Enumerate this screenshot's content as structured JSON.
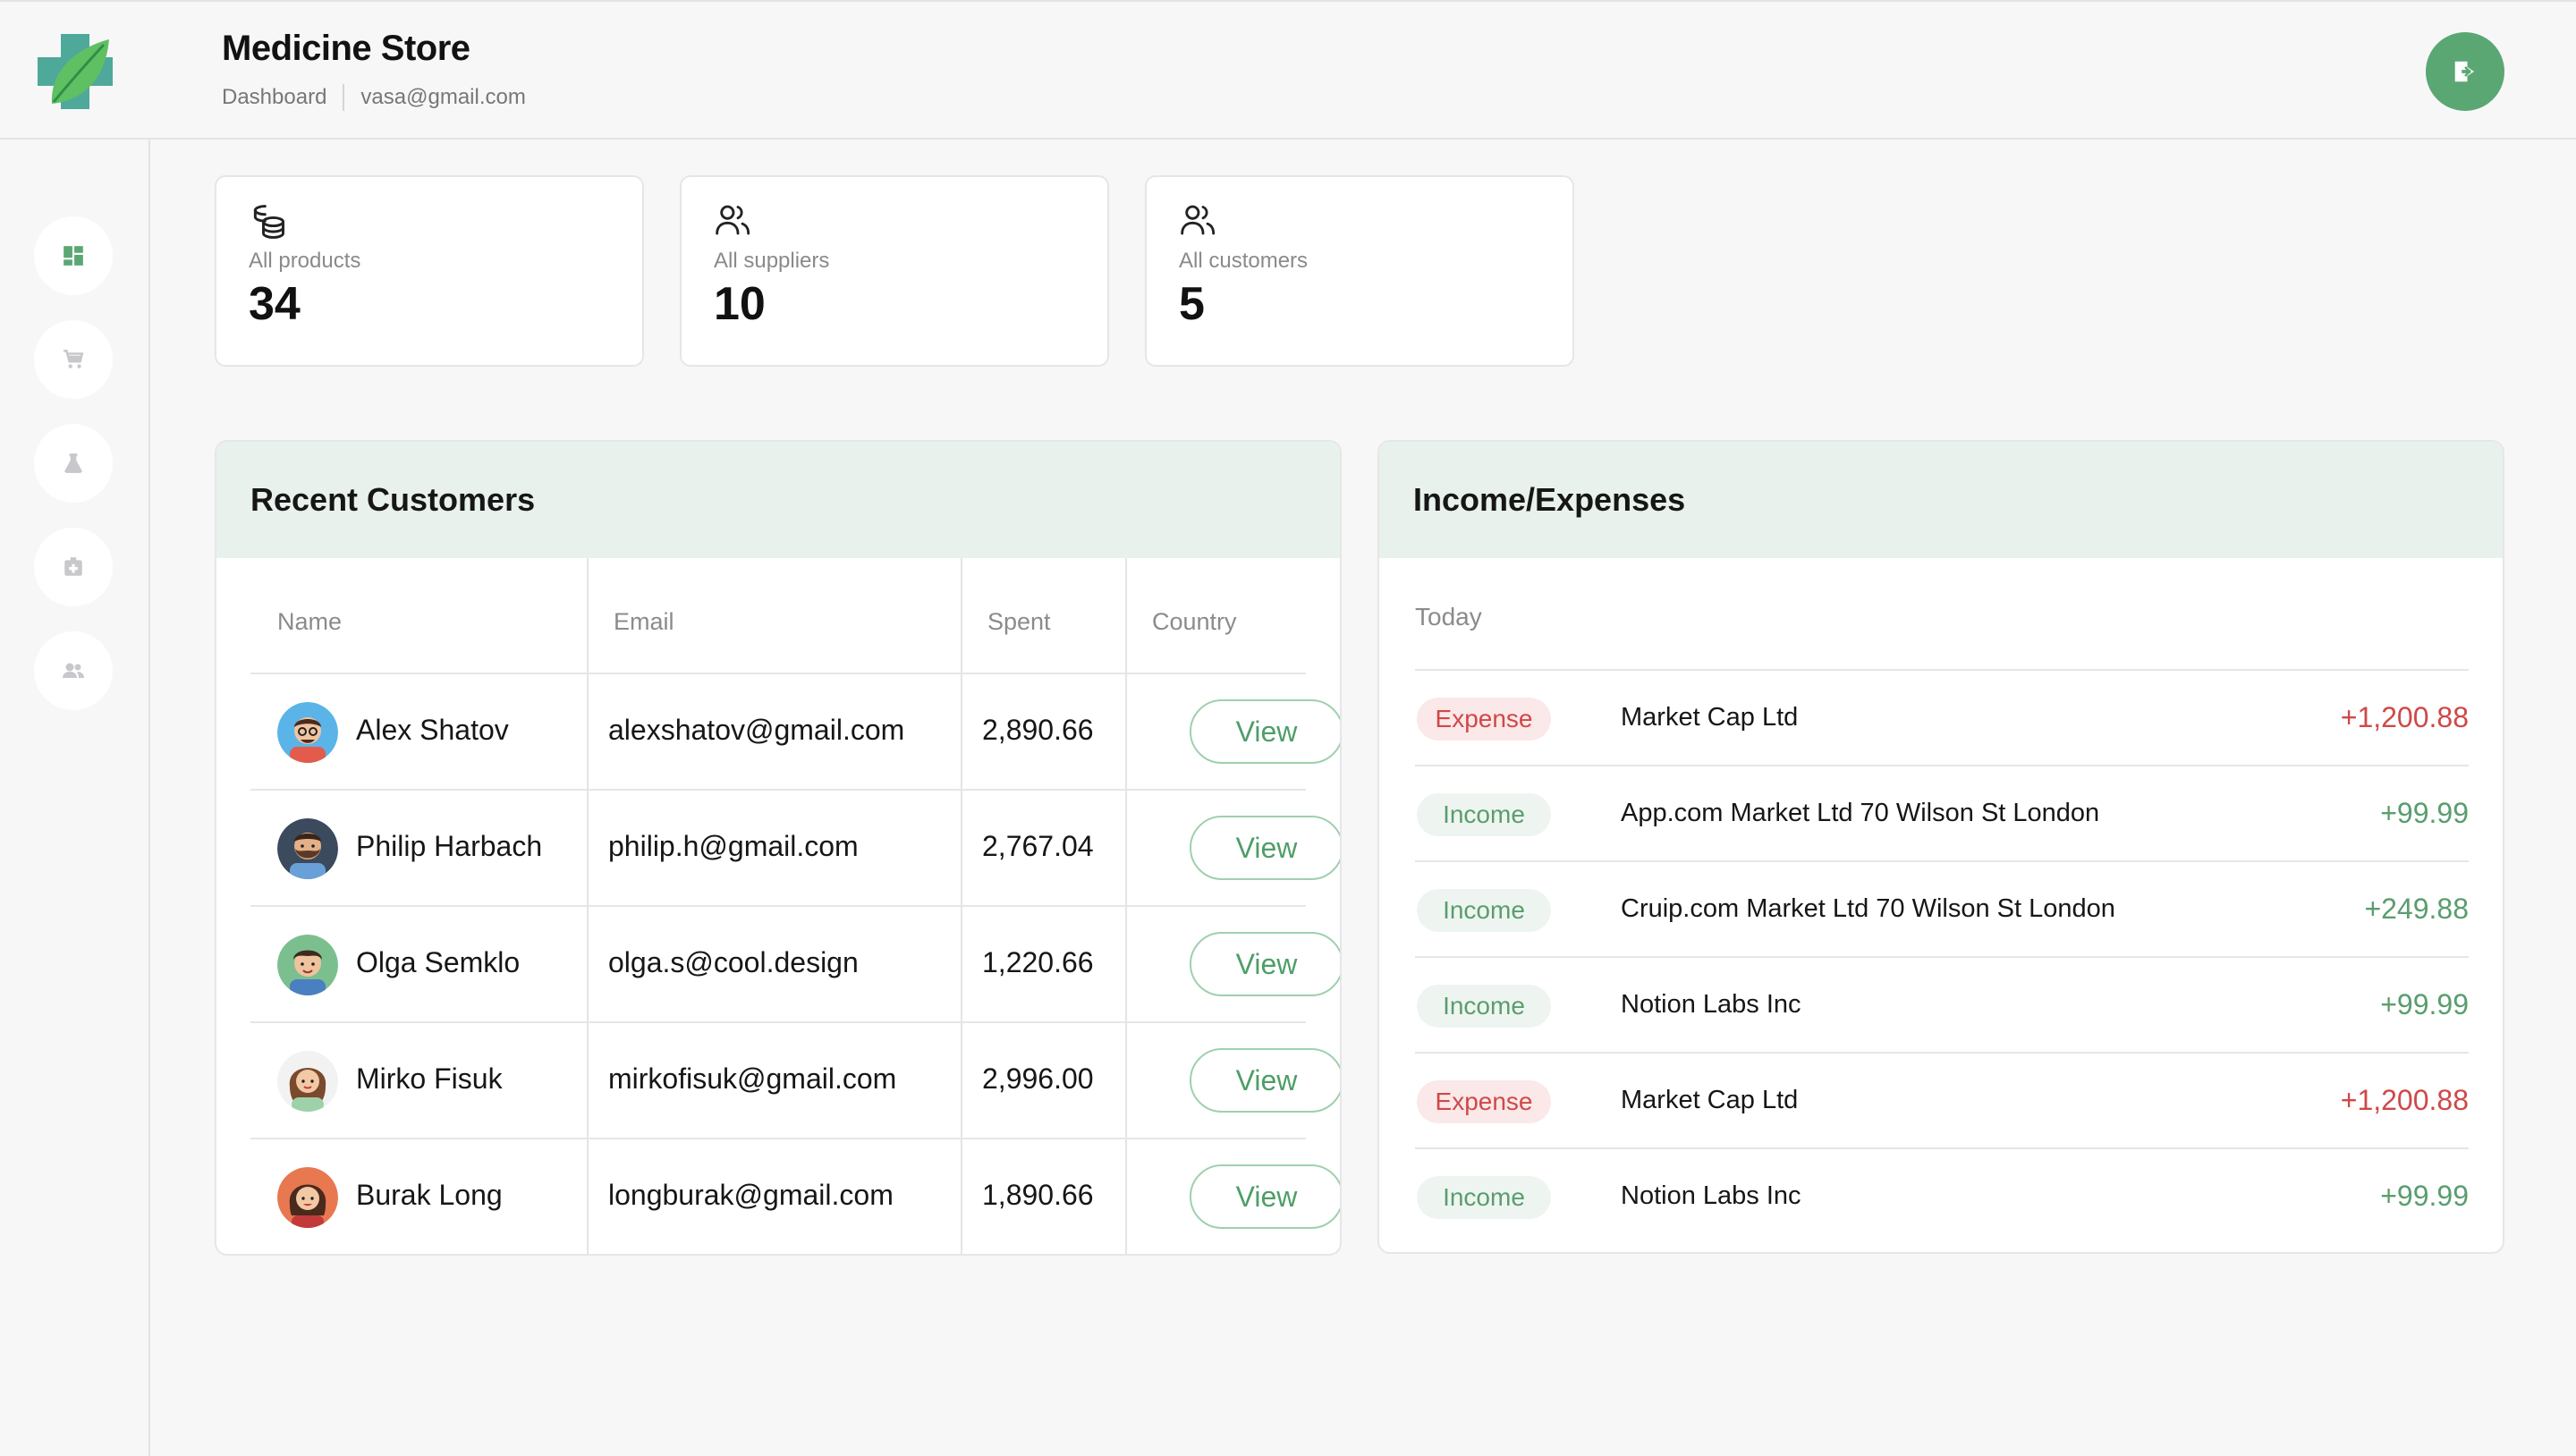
{
  "header": {
    "title": "Medicine Store",
    "breadcrumb": "Dashboard",
    "user_email": "vasa@gmail.com"
  },
  "colors": {
    "accent": "#5aa774",
    "panel_header": "#e9f1ec",
    "expense": "#d04848",
    "income": "#5a9d6e"
  },
  "sidebar": {
    "items": [
      {
        "icon": "dashboard-icon",
        "active": true
      },
      {
        "icon": "cart-icon",
        "active": false
      },
      {
        "icon": "flask-icon",
        "active": false
      },
      {
        "icon": "medicine-box-icon",
        "active": false
      },
      {
        "icon": "users-icon",
        "active": false
      }
    ]
  },
  "stats": [
    {
      "label": "All products",
      "value": "34",
      "icon": "coins-icon"
    },
    {
      "label": "All suppliers",
      "value": "10",
      "icon": "users-icon"
    },
    {
      "label": "All customers",
      "value": "5",
      "icon": "users-icon"
    }
  ],
  "recent_customers": {
    "title": "Recent Customers",
    "columns": [
      "Name",
      "Email",
      "Spent",
      "Country"
    ],
    "rows": [
      {
        "name": "Alex Shatov",
        "email": "alexshatov@gmail.com",
        "spent": "2,890.66",
        "action": "View"
      },
      {
        "name": "Philip Harbach",
        "email": "philip.h@gmail.com",
        "spent": "2,767.04",
        "action": "View"
      },
      {
        "name": "Olga Semklo",
        "email": "olga.s@cool.design",
        "spent": "1,220.66",
        "action": "View"
      },
      {
        "name": "Mirko Fisuk",
        "email": "mirkofisuk@gmail.com",
        "spent": "2,996.00",
        "action": "View"
      },
      {
        "name": "Burak Long",
        "email": "longburak@gmail.com",
        "spent": "1,890.66",
        "action": "View"
      }
    ]
  },
  "income_expenses": {
    "title": "Income/Expenses",
    "period": "Today",
    "rows": [
      {
        "type": "Expense",
        "description": "Market Cap Ltd",
        "amount": "+1,200.88"
      },
      {
        "type": "Income",
        "description": "App.com Market Ltd 70 Wilson St London",
        "amount": "+99.99"
      },
      {
        "type": "Income",
        "description": "Cruip.com Market Ltd 70 Wilson St London",
        "amount": "+249.88"
      },
      {
        "type": "Income",
        "description": "Notion Labs Inc",
        "amount": "+99.99"
      },
      {
        "type": "Expense",
        "description": "Market Cap Ltd",
        "amount": "+1,200.88"
      },
      {
        "type": "Income",
        "description": "Notion Labs Inc",
        "amount": "+99.99"
      }
    ]
  }
}
